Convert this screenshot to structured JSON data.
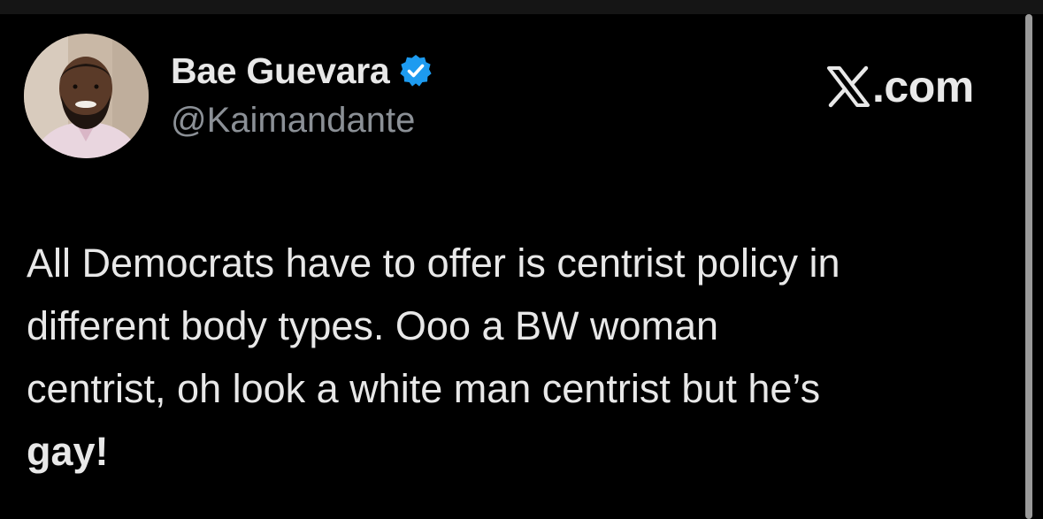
{
  "post": {
    "author": {
      "display_name": "Bae Guevara",
      "handle": "@Kaimandante",
      "verified": true,
      "avatar": "profile-photo"
    },
    "brand": {
      "icon": "x-logo-icon",
      "text": ".com"
    },
    "text_lines": [
      "All Democrats have to offer is centrist policy in",
      "different body types. Ooo a BW woman",
      "centrist, oh look a white man centrist but he’s",
      "gay!"
    ]
  },
  "colors": {
    "background": "#000000",
    "text": "#e8e8e8",
    "handle": "#8b9096",
    "verified_badge": "#1d9bf0"
  }
}
